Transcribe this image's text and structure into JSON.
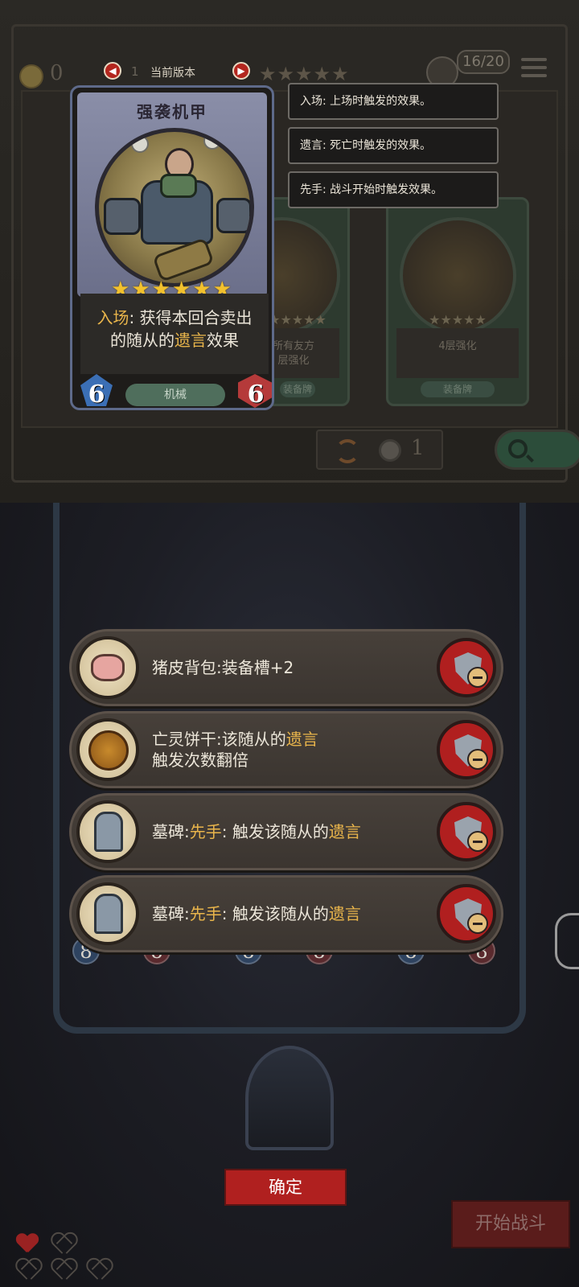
{
  "header": {
    "coins": "0",
    "version_label": "当前版本",
    "version_number": "1",
    "prev_icon": "chevron-left-icon",
    "next_icon": "chevron-right-icon",
    "slots": "16/20"
  },
  "shop": {
    "refresh_cost": "1",
    "dim_cards": [
      {
        "desc": "所有友方\n层强化",
        "tag": "装备牌"
      },
      {
        "desc": "4层强化",
        "tag": "装备牌"
      }
    ]
  },
  "card": {
    "title": "强袭机甲",
    "stars": "★★★★★★",
    "desc_kw1": "入场",
    "desc_part1": ": 获得本回合卖出",
    "desc_part2": "的随从的",
    "desc_kw2": "遗言",
    "desc_part3": "效果",
    "cost": "6",
    "health": "6",
    "type": "机械"
  },
  "tooltips": [
    "入场: 上场时触发的效果。",
    "遗言: 死亡时触发的效果。",
    "先手: 战斗开始时触发效果。"
  ],
  "equipment": [
    {
      "icon": "pig-backpack-icon",
      "name": "猪皮背包",
      "text": ":装备槽+2"
    },
    {
      "icon": "undead-cookie-icon",
      "name": "亡灵饼干",
      "text": ":该随从的",
      "kw": "遗言",
      "line2": "触发次数翻倍"
    },
    {
      "icon": "tombstone-icon",
      "name": "墓碑",
      "kw_pre": "先手",
      "text": ": 触发该随从的",
      "kw": "遗言"
    },
    {
      "icon": "tombstone-icon",
      "name": "墓碑",
      "kw_pre": "先手",
      "text": ": 触发该随从的",
      "kw": "遗言"
    }
  ],
  "board_chips": [
    "8",
    "8",
    "8",
    "8",
    "8",
    "8"
  ],
  "buttons": {
    "confirm": "确定",
    "start_battle": "开始战斗"
  },
  "colors": {
    "keyword": "#e9b54b",
    "star": "#f2c12e",
    "confirm_red": "#b0201f"
  }
}
